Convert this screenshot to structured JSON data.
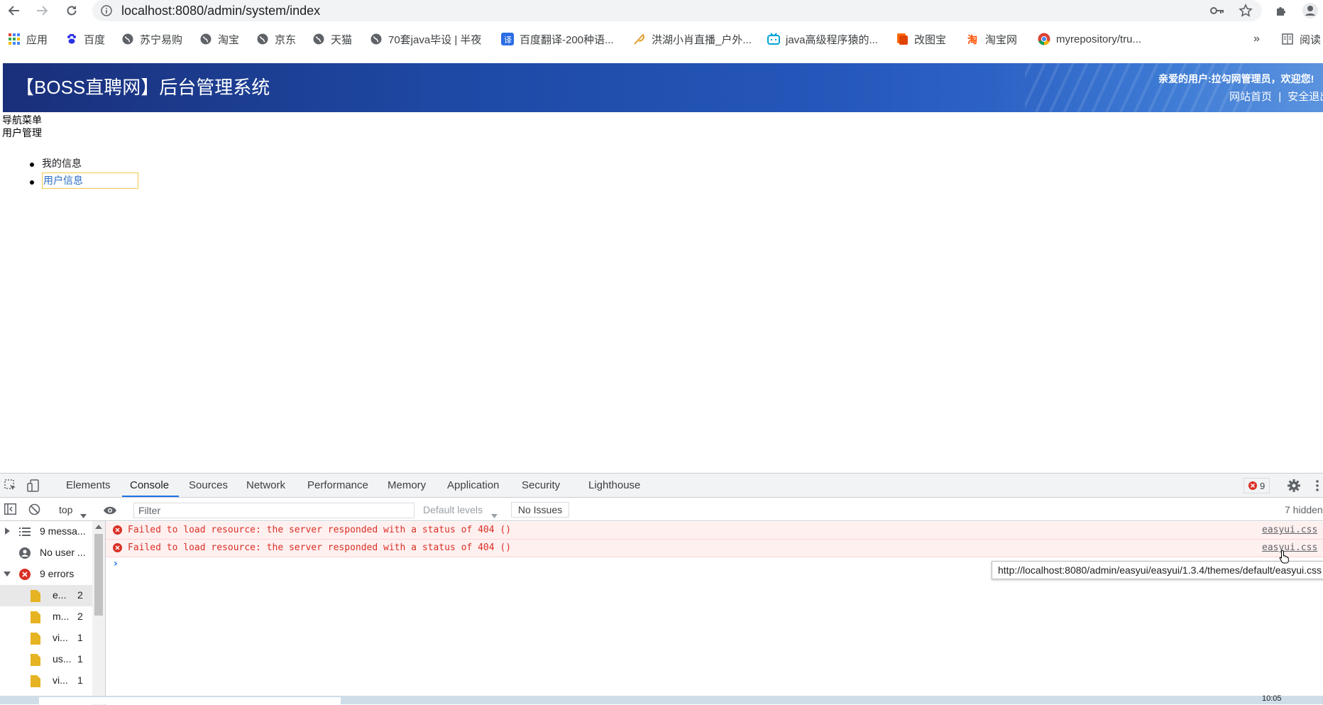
{
  "browser": {
    "url": "localhost:8080/admin/system/index",
    "bookmarks": [
      {
        "label": "应用",
        "icon": "apps-grid-icon"
      },
      {
        "label": "百度",
        "icon": "baidu-paw-icon"
      },
      {
        "label": "苏宁易购",
        "icon": "globe-icon"
      },
      {
        "label": "淘宝",
        "icon": "globe-icon"
      },
      {
        "label": "京东",
        "icon": "globe-icon"
      },
      {
        "label": "天猫",
        "icon": "globe-icon"
      },
      {
        "label": "70套java毕设 | 半夜",
        "icon": "globe-icon"
      },
      {
        "label": "百度翻译-200种语...",
        "icon": "translate-icon"
      },
      {
        "label": "洪湖小肖直播_户外...",
        "icon": "feather-icon"
      },
      {
        "label": "java高级程序猿的...",
        "icon": "bilibili-icon"
      },
      {
        "label": "改图宝",
        "icon": "orange-app-icon"
      },
      {
        "label": "淘宝网",
        "icon": "taobao-icon"
      },
      {
        "label": "myrepository/tru...",
        "icon": "chrome-icon"
      }
    ],
    "more_label": "»",
    "reading_list_label": "阅读"
  },
  "page": {
    "banner_title": "【BOSS直聘网】后台管理系统",
    "welcome": "亲爱的用户:拉勾网管理员，欢迎您!",
    "link_home": "网站首页",
    "link_sep": "|",
    "link_logout": "安全退出",
    "nav_title": "导航菜单",
    "nav_group": "用户管理",
    "menu": [
      "我的信息",
      "用户信息"
    ]
  },
  "devtools": {
    "tabs": [
      "Elements",
      "Console",
      "Sources",
      "Network",
      "Performance",
      "Memory",
      "Application",
      "Security",
      "Lighthouse"
    ],
    "active_tab": "Console",
    "error_count": "9",
    "context": "top",
    "filter_placeholder": "Filter",
    "levels": "Default levels",
    "issues": "No Issues",
    "hidden": "7 hidden",
    "sidebar": [
      {
        "label": "9 messa...",
        "icon": "list-icon"
      },
      {
        "label": "No user ...",
        "icon": "user-icon"
      },
      {
        "label": "9 errors",
        "icon": "error-icon"
      },
      {
        "label": "e...",
        "count": "2",
        "icon": "file-icon"
      },
      {
        "label": "m...",
        "count": "2",
        "icon": "file-icon"
      },
      {
        "label": "vi...",
        "count": "1",
        "icon": "file-icon"
      },
      {
        "label": "us...",
        "count": "1",
        "icon": "file-icon"
      },
      {
        "label": "vi...",
        "count": "1",
        "icon": "file-icon"
      }
    ],
    "messages": [
      {
        "text": "Failed to load resource: the server responded with a status of 404 ()",
        "source": "easyui.css"
      },
      {
        "text": "Failed to load resource: the server responded with a status of 404 ()",
        "source": "easyui.css"
      }
    ],
    "prompt": "›",
    "tooltip": "http://localhost:8080/admin/easyui/easyui/1.3.4/themes/default/easyui.css"
  },
  "taskbar": {
    "clock": "10:05"
  },
  "colors": {
    "banner": "#1e4aa6",
    "error": "#d93025",
    "accent": "#1a73e8"
  }
}
